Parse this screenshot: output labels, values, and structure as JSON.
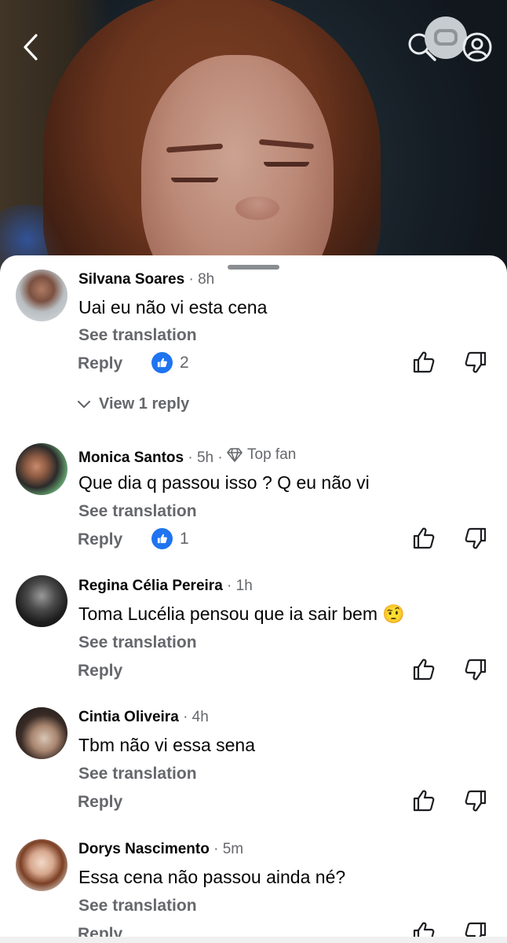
{
  "video": {
    "back_icon": "chevron-left-icon",
    "search_icon": "search-icon",
    "tv_icon": "globo-tv-icon",
    "profile_icon": "profile-icon"
  },
  "comments": [
    {
      "author": "Silvana Soares",
      "time": "8h",
      "text": "Uai eu não vi esta cena",
      "see_translation": "See translation",
      "reply": "Reply",
      "like_count": "2",
      "view_replies": "View 1 reply"
    },
    {
      "author": "Monica Santos",
      "time": "5h",
      "badge": "Top fan",
      "text": "Que dia q passou isso ? Q eu não vi",
      "see_translation": "See translation",
      "reply": "Reply",
      "like_count": "1"
    },
    {
      "author": "Regina Célia Pereira",
      "time": "1h",
      "text": "Toma Lucélia pensou que ia sair bem",
      "emoji": "🤨",
      "see_translation": "See translation",
      "reply": "Reply"
    },
    {
      "author": "Cintia Oliveira",
      "time": "4h",
      "text": "Tbm não vi essa sena",
      "see_translation": "See translation",
      "reply": "Reply"
    },
    {
      "author": "Dorys Nascimento",
      "time": "5m",
      "text": "Essa cena não passou ainda né?",
      "see_translation": "See translation",
      "reply": "Reply"
    }
  ],
  "separator": "·",
  "colors": {
    "like_blue": "#1f74f0",
    "secondary_text": "#65676b",
    "primary_text": "#050505"
  }
}
